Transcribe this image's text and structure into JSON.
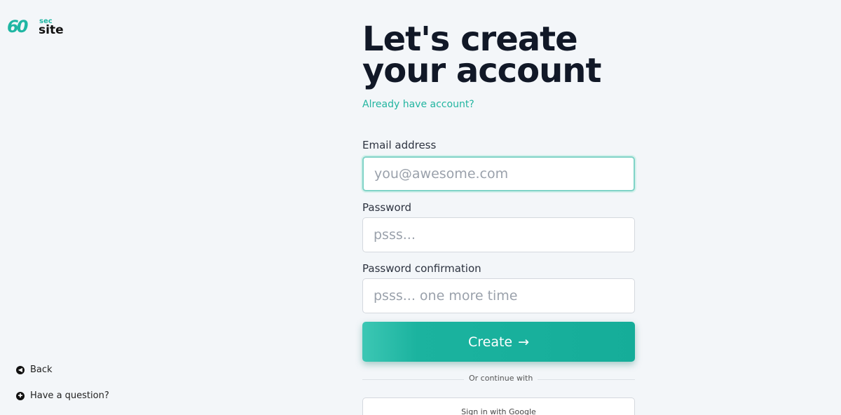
{
  "brand": {
    "logo_number": "60",
    "logo_sec": "sec",
    "logo_site": "site"
  },
  "form": {
    "title": "Let's create your account",
    "already_link": "Already have account?",
    "email": {
      "label": "Email address",
      "placeholder": "you@awesome.com",
      "value": ""
    },
    "password": {
      "label": "Password",
      "placeholder": "psss...",
      "value": ""
    },
    "password_confirmation": {
      "label": "Password confirmation",
      "placeholder": "psss... one more time",
      "value": ""
    },
    "create_button": "Create",
    "create_arrow": "→",
    "divider_text": "Or continue with",
    "google_button": "Sign in with Google"
  },
  "side_links": {
    "back": "Back",
    "question": "Have a question?"
  },
  "icons": {
    "back": "arrow-left-circle-icon",
    "question": "lifebuoy-icon",
    "create": "arrow-right-icon"
  },
  "colors": {
    "accent": "#1fb6a3",
    "background": "#f3f6f9",
    "title": "#111827"
  }
}
